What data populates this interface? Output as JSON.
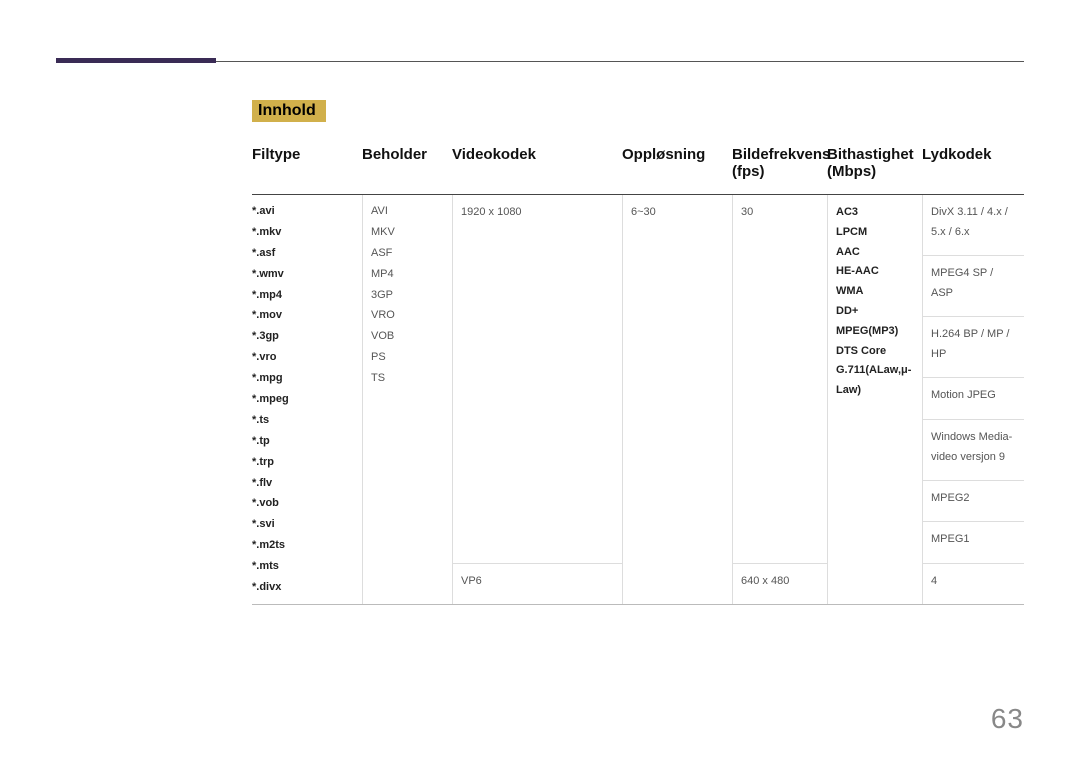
{
  "section_label": "Innhold",
  "headers": {
    "filtype": "Filtype",
    "beholder": "Beholder",
    "videokodek": "Videokodek",
    "opplosning": "Oppløsning",
    "bildefrekvens": "Bildefrekvens (fps)",
    "bithastighet": "Bithastighet (Mbps)",
    "lydkodek": "Lydkodek"
  },
  "filetypes": [
    "*.avi",
    "*.mkv",
    "*.asf",
    "*.wmv",
    "*.mp4",
    "*.mov",
    "*.3gp",
    "*.vro",
    "*.mpg",
    "*.mpeg",
    "*.ts",
    "*.tp",
    "*.trp",
    "*.flv",
    "*.vob",
    "*.svi",
    "*.m2ts",
    "*.mts",
    "*.divx"
  ],
  "containers": [
    "AVI",
    "MKV",
    "ASF",
    "MP4",
    "3GP",
    "VRO",
    "VOB",
    "PS",
    "TS"
  ],
  "video_rows": [
    {
      "codec": "DivX 3.11 / 4.x / 5.x / 6.x",
      "res": "1920 x 1080",
      "fps": "6~30",
      "bitrate": "30"
    },
    {
      "codec": "MPEG4 SP / ASP"
    },
    {
      "codec": "H.264 BP / MP / HP"
    },
    {
      "codec": "Motion JPEG"
    },
    {
      "codec": "Windows Media-video versjon 9"
    },
    {
      "codec": "MPEG2"
    },
    {
      "codec": "MPEG1"
    },
    {
      "codec": "VP6",
      "res": "640 x 480",
      "bitrate": "4"
    }
  ],
  "audio_codecs": [
    "AC3",
    "LPCM",
    "AAC",
    "HE-AAC",
    "WMA",
    "DD+",
    "MPEG(MP3)",
    "DTS Core",
    "G.711(ALaw,μ-Law)"
  ],
  "page_number": "63"
}
